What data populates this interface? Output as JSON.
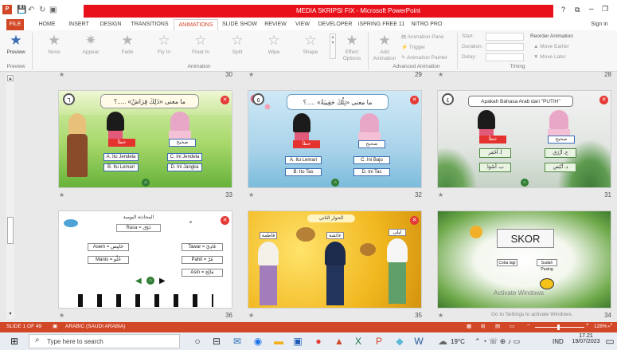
{
  "window": {
    "title": "MEDIA SKRIPSI FIX - Microsoft PowerPoint",
    "help": "?",
    "minimize": "–",
    "restore": "❐",
    "signin": "Sign in"
  },
  "tabs": [
    {
      "label": "FILE"
    },
    {
      "label": "HOME"
    },
    {
      "label": "INSERT"
    },
    {
      "label": "DESIGN"
    },
    {
      "label": "TRANSITIONS"
    },
    {
      "label": "ANIMATIONS"
    },
    {
      "label": "SLIDE SHOW"
    },
    {
      "label": "REVIEW"
    },
    {
      "label": "VIEW"
    },
    {
      "label": "DEVELOPER"
    },
    {
      "label": "iSPRING FREE 11"
    },
    {
      "label": "NITRO PRO"
    }
  ],
  "ribbon": {
    "preview": {
      "label": "Preview",
      "group": "Preview"
    },
    "animations": [
      {
        "label": "None",
        "icon": "star-icon"
      },
      {
        "label": "Appear",
        "icon": "star-burst-icon"
      },
      {
        "label": "Fade",
        "icon": "star-icon"
      },
      {
        "label": "Fly In",
        "icon": "star-icon"
      },
      {
        "label": "Float In",
        "icon": "star-icon"
      },
      {
        "label": "Split",
        "icon": "star-icon"
      },
      {
        "label": "Wipe",
        "icon": "star-icon"
      },
      {
        "label": "Shape",
        "icon": "star-icon"
      }
    ],
    "effect_options": "Effect\nOptions",
    "animation_group": "Animation",
    "add_animation": "Add\nAnimation",
    "animation_pane": "Animation Pane",
    "trigger": "Trigger",
    "animation_painter": "Animation Painter",
    "advanced_group": "Advanced Animation",
    "start": "Start:",
    "duration": "Duration:",
    "delay": "Delay:",
    "reorder": "Reorder Animation",
    "move_earlier": "▲ Move Earlier",
    "move_later": "▼ Move Later",
    "timing_group": "Timing"
  },
  "top_numbers": [
    "30",
    "29",
    "28"
  ],
  "slides": [
    {
      "number": "33",
      "badge": "٦",
      "question": "ما معنى «ذَلِكَ فِرَاشٌ» .....؟",
      "answers": [
        "A. Itu Jendela",
        "B. Itu Lemari",
        "C. Ini Jendela",
        "D. Ini Jangka"
      ],
      "labels": [
        "خطأ",
        "صحيح"
      ]
    },
    {
      "number": "32",
      "badge": "٥",
      "question": "ما معنى «تِلْكَ حَقِيبَةٌ» .....؟",
      "answers": [
        "A. Itu Lemari",
        "B. Itu Tas",
        "C. Ini Baju",
        "D. Ini Tas"
      ],
      "labels": [
        "خطأ",
        "صحيح"
      ]
    },
    {
      "number": "31",
      "badge": "٤",
      "question": "Apakah Bahasa Arab dari \"PUTIH\"",
      "answers": [
        "أ. أَحْمَر",
        "ب. أَسْوَدُ",
        "ج. أَزْرَق",
        "د. أَبْيَض"
      ],
      "labels": [
        "خطأ",
        "صحيح"
      ]
    },
    {
      "number": "36",
      "heading": "المحادثة اليومية",
      "rasa": "Rasa = ذَوْق",
      "rows_left": [
        "Asem = حَامِض",
        "Manis = حُلْو"
      ],
      "rows_right": [
        "Tawar = عَادِيّ",
        "Pahit = مُرّ",
        "Asin = مَالِح"
      ]
    },
    {
      "number": "35",
      "heading": "الحوار الثاني",
      "names": [
        "فاطمة",
        "عائشة",
        "ليلى"
      ]
    },
    {
      "number": "34",
      "title": "SKOR",
      "boxes": [
        "Coba lagi",
        "Sudah Pusing"
      ],
      "watermark": "Activate Windows",
      "watermark2": "Go to Settings to activate Windows."
    }
  ],
  "status": {
    "slide": "SLIDE 1 OF 49",
    "language": "ARABIC (SAUDI ARABIA)",
    "zoom": "128%"
  },
  "taskbar": {
    "search_placeholder": "Type here to search",
    "weather": "19°C",
    "lang": "IND",
    "time": "17.21",
    "date": "19/07/2023"
  },
  "colors": {
    "accent": "#d24726",
    "titlebar_red": "#e8101a"
  }
}
